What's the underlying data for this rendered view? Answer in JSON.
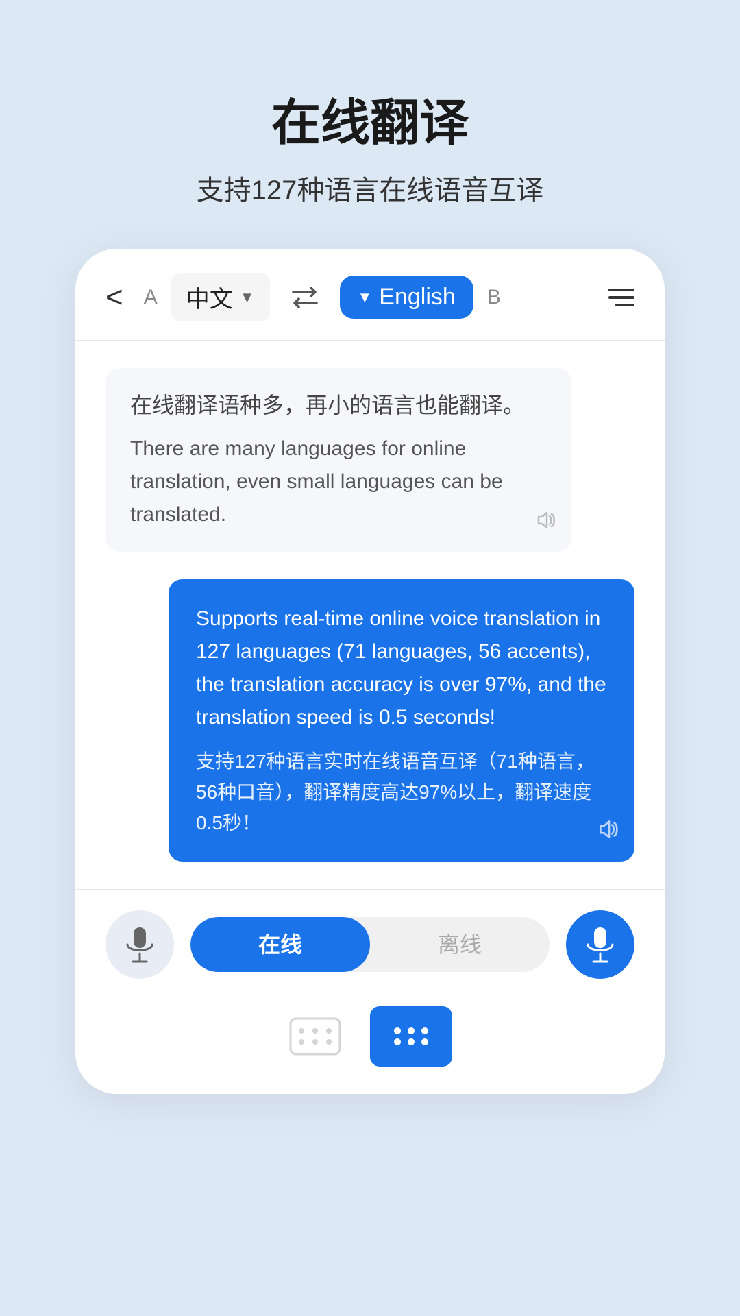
{
  "header": {
    "title": "在线翻译",
    "subtitle": "支持127种语言在线语音互译"
  },
  "nav": {
    "back_label": "<",
    "lang_a_label": "A",
    "source_lang": "中文",
    "swap_symbol": "⇌",
    "target_lang": "English",
    "lang_b_label": "B"
  },
  "chat": {
    "bubble_left": {
      "source": "在线翻译语种多，再小的语言也能翻译。",
      "translation": "There are many languages for online translation, even small languages can be translated."
    },
    "bubble_right": {
      "en": "Supports real-time online voice translation in 127 languages (71 languages, 56 accents), the translation accuracy is over 97%, and the translation speed is 0.5 seconds!",
      "zh": "支持127种语言实时在线语音互译（71种语言，56种口音），翻译精度高达97%以上，翻译速度0.5秒！"
    }
  },
  "bottom": {
    "online_label": "在线",
    "offline_label": "离线"
  }
}
